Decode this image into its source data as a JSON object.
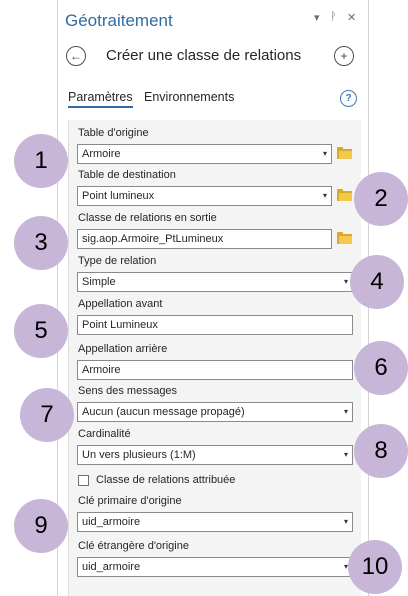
{
  "pane": {
    "title": "Géotraitement",
    "menu_glyph": "▾",
    "pin_glyph": "ᚹ",
    "close_glyph": "✕"
  },
  "tool": {
    "back_glyph": "←",
    "title": "Créer une classe de relations",
    "add_glyph": "+"
  },
  "tabs": {
    "parameters": "Paramètres",
    "environments": "Environnements",
    "help_glyph": "?"
  },
  "fields": {
    "origin_table": {
      "label": "Table d'origine",
      "value": "Armoire"
    },
    "destination_table": {
      "label": "Table de destination",
      "value": "Point lumineux"
    },
    "output_class": {
      "label": "Classe de relations en sortie",
      "value": "sig.aop.Armoire_PtLumineux"
    },
    "relation_type": {
      "label": "Type de relation",
      "value": "Simple"
    },
    "forward_label": {
      "label": "Appellation avant",
      "value": "Point Lumineux"
    },
    "backward_label": {
      "label": "Appellation arrière",
      "value": "Armoire"
    },
    "message_direction": {
      "label": "Sens des messages",
      "value": "Aucun (aucun message propagé)"
    },
    "cardinality": {
      "label": "Cardinalité",
      "value": "Un vers plusieurs (1:M)"
    },
    "attributed": {
      "label": "Classe de relations attribuée",
      "checked": false
    },
    "origin_primary_key": {
      "label": "Clé primaire d'origine",
      "value": "uid_armoire"
    },
    "origin_foreign_key": {
      "label": "Clé étrangère d'origine",
      "value": "uid_armoire"
    }
  },
  "dropdown_caret": "▾",
  "badges": [
    "1",
    "2",
    "3",
    "4",
    "5",
    "6",
    "7",
    "8",
    "9",
    "10"
  ],
  "colors": {
    "accent": "#2f6ca6",
    "badge": "#c8b6d8",
    "folder": "#f2c94c"
  }
}
